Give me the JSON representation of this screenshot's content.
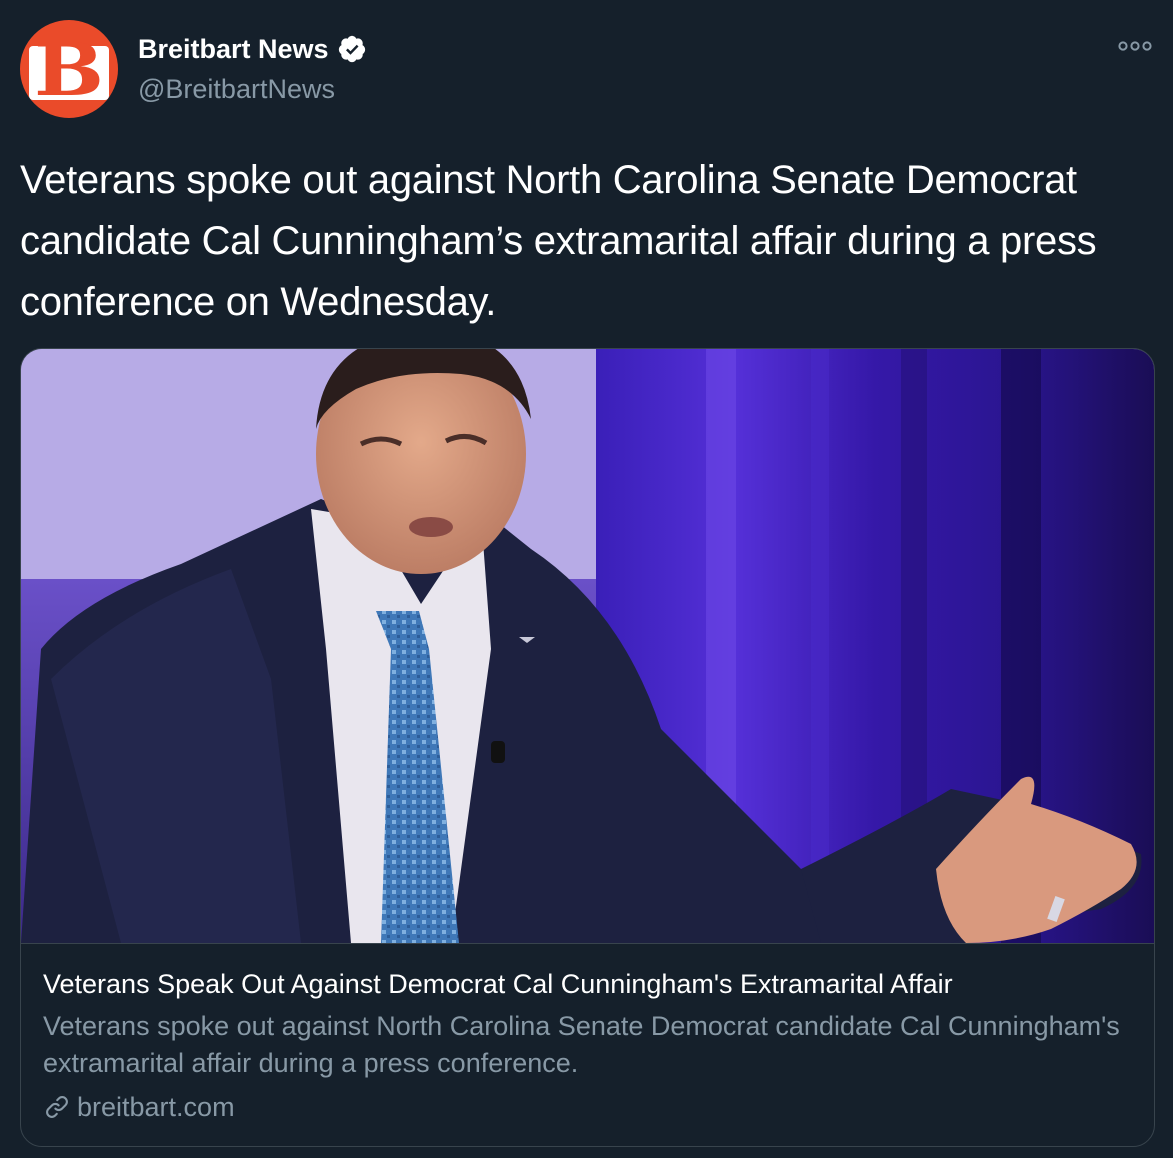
{
  "header": {
    "avatar_letter": "B",
    "display_name": "Breitbart News",
    "handle": "@BreitbartNews",
    "verified_icon": "verified-badge-icon",
    "more_icon": "more-options-icon"
  },
  "tweet": {
    "text": "Veterans spoke out against North Carolina Senate Democrat candidate Cal Cunningham’s extramarital affair during a press conference on Wednesday."
  },
  "card": {
    "image_icon": "photo-man-in-suit",
    "title": "Veterans Speak Out Against Democrat Cal Cunningham's Extramarital Affair",
    "description": "Veterans spoke out against North Carolina Senate Democrat candidate Cal Cunningham's extramarital affair during a press conference.",
    "domain": "breitbart.com",
    "link_icon": "link-icon"
  },
  "colors": {
    "background": "#15202b",
    "text_primary": "#ffffff",
    "text_secondary": "#8899a6",
    "border": "#38444d",
    "brand": "#ea4b2a"
  }
}
